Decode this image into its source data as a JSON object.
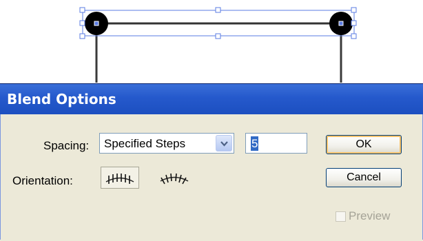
{
  "artboard": {
    "objects": [
      {
        "type": "blend-path",
        "name": "blend-spine"
      }
    ]
  },
  "dialog": {
    "title": "Blend Options",
    "spacing": {
      "label": "Spacing:",
      "selected": "Specified Steps",
      "steps_value": "5"
    },
    "orientation": {
      "label": "Orientation:",
      "options": [
        {
          "name": "align-to-page",
          "selected": true
        },
        {
          "name": "align-to-path",
          "selected": false
        }
      ]
    },
    "buttons": {
      "ok": "OK",
      "cancel": "Cancel"
    },
    "preview": {
      "label": "Preview",
      "checked": false,
      "enabled": false
    }
  },
  "colors": {
    "titlebar": "#245edb",
    "dialog_bg": "#ece9d8",
    "selection_handles": "#3b5fd9",
    "selected_text_bg": "#316ac5"
  }
}
